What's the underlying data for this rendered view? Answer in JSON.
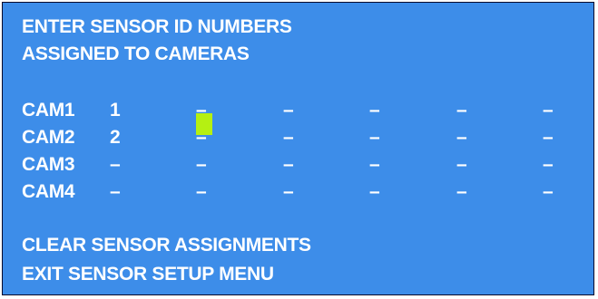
{
  "header": {
    "line1": "ENTER SENSOR ID NUMBERS",
    "line2": "ASSIGNED TO CAMERAS"
  },
  "cameras": [
    {
      "label": "CAM1",
      "slots": [
        "1",
        "–",
        "–",
        "–",
        "–",
        "–"
      ]
    },
    {
      "label": "CAM2",
      "slots": [
        "2",
        "–",
        "–",
        "–",
        "–",
        "–"
      ]
    },
    {
      "label": "CAM3",
      "slots": [
        "–",
        "–",
        "–",
        "–",
        "–",
        "–"
      ]
    },
    {
      "label": "CAM4",
      "slots": [
        "–",
        "–",
        "–",
        "–",
        "–",
        "–"
      ]
    }
  ],
  "menu": {
    "clear": "CLEAR SENSOR ASSIGNMENTS",
    "exit": "EXIT SENSOR SETUP MENU"
  },
  "colors": {
    "background": "#3d8de9",
    "text": "#ffffff",
    "cursor": "#b5f012"
  }
}
